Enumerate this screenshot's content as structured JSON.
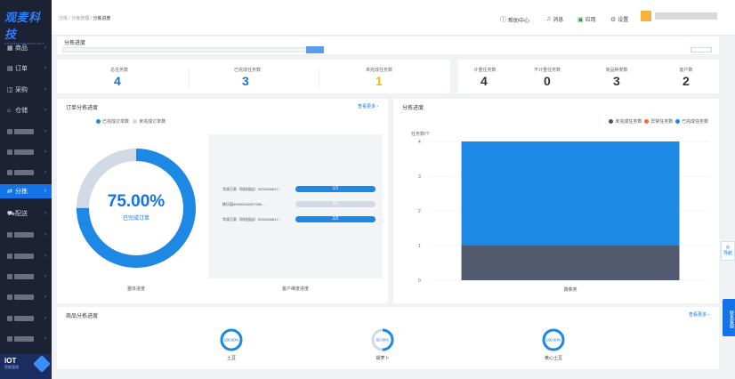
{
  "brand": {
    "name": "观麦科技",
    "sub": "GUANMAITECHNOLOGY"
  },
  "sidebar": {
    "items": [
      {
        "label": "商品",
        "icon": "grid-icon"
      },
      {
        "label": "订单",
        "icon": "order-icon"
      },
      {
        "label": "采购",
        "icon": "purchase-icon"
      },
      {
        "label": "仓储",
        "icon": "warehouse-icon"
      },
      {
        "label": "分拣",
        "icon": "sorting-icon"
      },
      {
        "label": "配送",
        "icon": "delivery-icon"
      }
    ],
    "iot": {
      "title": "IOT",
      "sub": "智能管理"
    }
  },
  "breadcrumb": {
    "a": "分拣",
    "b": "分拣管理",
    "c": "分拣进度"
  },
  "topbar": {
    "help": "帮助中心",
    "notify": "消息",
    "app": "应用",
    "settings": "设置"
  },
  "filter": {
    "title": "分拣进度"
  },
  "stats_left": [
    {
      "label": "总任务数",
      "value": "4",
      "color": "#1473e6"
    },
    {
      "label": "已完成任务数",
      "value": "3",
      "color": "#1473e6"
    },
    {
      "label": "未完成任务数",
      "value": "1",
      "color": "#f5b800"
    }
  ],
  "stats_right": [
    {
      "label": "计重任务数",
      "value": "4"
    },
    {
      "label": "不计重任务数",
      "value": "0"
    },
    {
      "label": "商品种类数",
      "value": "3"
    },
    {
      "label": "客户数",
      "value": "2"
    }
  ],
  "order_panel": {
    "title": "订单分拣进度",
    "more": "查看更多",
    "legend": [
      "已完成订单数",
      "未完成订单数"
    ],
    "percent": "75.00%",
    "percent_label": "已完成订单",
    "percent_value": 0.75,
    "ring_caption": "整体进度",
    "rows": [
      {
        "label": "华润万家（科技园店）2/OD240617...",
        "value": "1/1",
        "fill": 1.0
      },
      {
        "label": "桃乐园4H/OD240327000...",
        "value": "0/1",
        "fill": 0.0
      },
      {
        "label": "华润万家（科技园店）2/OD240617...",
        "value": "2/2",
        "fill": 1.0
      }
    ],
    "rows_caption": "客户维度进度"
  },
  "task_panel": {
    "title": "分拣进度",
    "legend": [
      {
        "label": "未完成任务数",
        "color": "#4a5568"
      },
      {
        "label": "异常任务数",
        "color": "#f06a3a"
      },
      {
        "label": "已完成任务数",
        "color": "#1e88e5"
      }
    ]
  },
  "chart_data": {
    "type": "bar",
    "stacked": true,
    "categories": [
      "蔬菜类"
    ],
    "series": [
      {
        "name": "未完成任务数",
        "values": [
          1
        ],
        "color": "#515a6e"
      },
      {
        "name": "异常任务数",
        "values": [
          0
        ],
        "color": "#f06a3a"
      },
      {
        "name": "已完成任务数",
        "values": [
          3
        ],
        "color": "#1e88e5"
      }
    ],
    "ylabel": "任务数/个",
    "yticks": [
      "0",
      "1",
      "2",
      "3",
      "4"
    ],
    "ylim": [
      0,
      4
    ],
    "legend_position": "top-right"
  },
  "goods_panel": {
    "title": "商品分拣进度",
    "more": "查看更多",
    "items": [
      {
        "name": "土豆",
        "percent": "100.00%",
        "value": 1.0
      },
      {
        "name": "胡萝卜",
        "percent": "50.00%",
        "value": 0.5
      },
      {
        "name": "黄心土豆",
        "percent": "100.00%",
        "value": 1.0
      }
    ]
  },
  "side_tabs": {
    "guide": "导航",
    "service": "联系客服"
  }
}
